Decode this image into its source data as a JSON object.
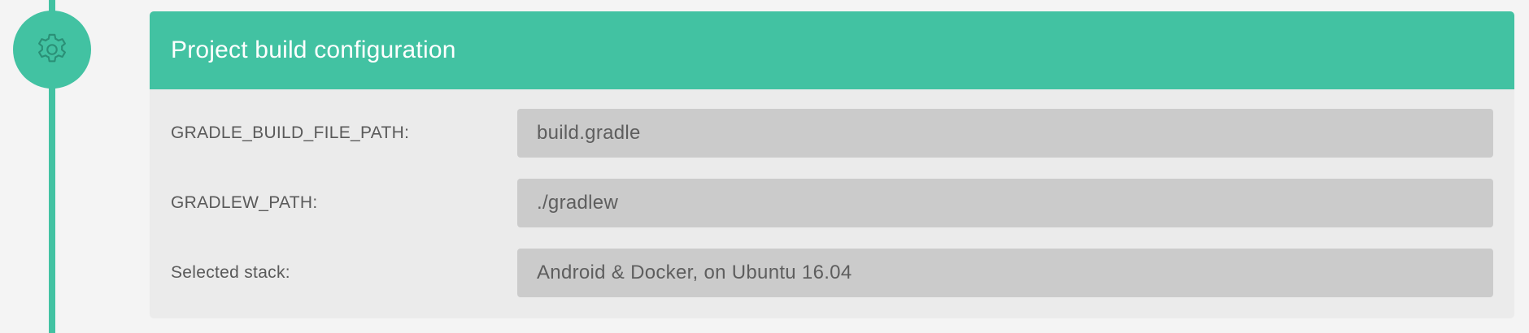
{
  "step": {
    "icon": "gear-icon",
    "color": "#42c2a2"
  },
  "card": {
    "title": "Project build configuration",
    "header_color": "#42c2a2",
    "rows": [
      {
        "label": "GRADLE_BUILD_FILE_PATH:",
        "value": "build.gradle"
      },
      {
        "label": "GRADLEW_PATH:",
        "value": "./gradlew"
      },
      {
        "label": "Selected stack:",
        "value": "Android & Docker, on Ubuntu 16.04"
      }
    ]
  }
}
